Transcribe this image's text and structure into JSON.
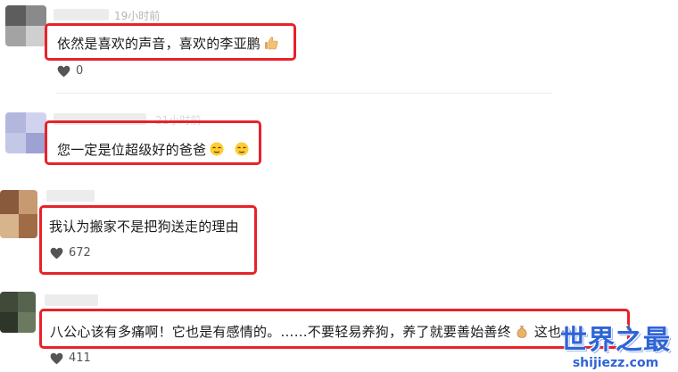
{
  "comments": [
    {
      "timestamp": "19小时前",
      "text": "依然是喜欢的声音，喜欢的李亚鹏",
      "emoji": "thumbs-up",
      "likes": "0"
    },
    {
      "timestamp": "21小时前",
      "text": "您一定是位超级好的爸爸",
      "emoji": "relieved-face",
      "likes": ""
    },
    {
      "timestamp": "",
      "text": "我认为搬家不是把狗送走的理由",
      "emoji": "",
      "likes": "672"
    },
    {
      "timestamp": "",
      "text": "八公心该有多痛啊！它也是有感情的。……不要轻易养狗，养了就要善始善终",
      "text_tail": "这也一",
      "emoji": "money-bag",
      "likes": "411"
    }
  ],
  "watermark": {
    "title": "世界之最",
    "url": "shijiezz.com"
  },
  "colors": {
    "highlight": "#e8222a",
    "watermark": "#2f64d6",
    "timestamp": "#b5b5b5",
    "heart": "#555555"
  }
}
